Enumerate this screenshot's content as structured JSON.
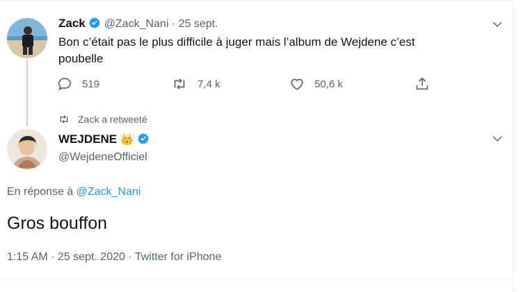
{
  "tweet1": {
    "name": "Zack",
    "handle": "@Zack_Nani",
    "separator": "·",
    "date": "25 sept.",
    "text_line1": "Bon c’était pas le plus difficile à juger mais l’album de Wejdene c’est",
    "text_line2": "poubelle",
    "replies": "519",
    "retweets": "7,4 k",
    "likes": "50,6 k"
  },
  "retweet_notice": "Zack a retweeté",
  "tweet2": {
    "name": "WEJDENE",
    "crown_emoji": "👑",
    "handle": "@WejdeneOfficiel",
    "reply_prefix": "En réponse à",
    "reply_to": "@Zack_Nani",
    "text": "Gros bouffon",
    "meta": "1:15 AM · 25 sept. 2020 · Twitter for iPhone"
  },
  "colors": {
    "accent": "#1d9bf0",
    "muted": "#536471",
    "text": "#0f1419"
  },
  "icons": [
    "reply-icon",
    "retweet-icon",
    "like-icon",
    "share-icon",
    "chevron-down-icon",
    "verified-badge-icon"
  ]
}
